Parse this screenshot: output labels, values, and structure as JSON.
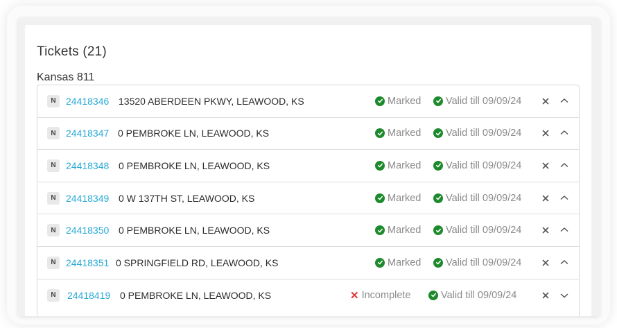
{
  "header": {
    "title": "Tickets (21)",
    "subtitle": "Kansas 811"
  },
  "colors": {
    "link": "#27a9d6",
    "success": "#1e8a2e",
    "error": "#e53935",
    "muted": "#8a8a8a"
  },
  "tickets": [
    {
      "badge": "N",
      "id": "24418346",
      "address": "13520 ABERDEEN PKWY, LEAWOOD, KS",
      "status": "Marked",
      "status_icon": "check-circle-icon",
      "valid": "Valid till 09/09/24",
      "expanded": true
    },
    {
      "badge": "N",
      "id": "24418347",
      "address": "0 PEMBROKE LN, LEAWOOD, KS",
      "status": "Marked",
      "status_icon": "check-circle-icon",
      "valid": "Valid till 09/09/24",
      "expanded": true
    },
    {
      "badge": "N",
      "id": "24418348",
      "address": "0 PEMBROKE LN, LEAWOOD, KS",
      "status": "Marked",
      "status_icon": "check-circle-icon",
      "valid": "Valid till 09/09/24",
      "expanded": true
    },
    {
      "badge": "N",
      "id": "24418349",
      "address": "0 W 137TH ST, LEAWOOD, KS",
      "status": "Marked",
      "status_icon": "check-circle-icon",
      "valid": "Valid till 09/09/24",
      "expanded": true
    },
    {
      "badge": "N",
      "id": "24418350",
      "address": "0 PEMBROKE LN, LEAWOOD, KS",
      "status": "Marked",
      "status_icon": "check-circle-icon",
      "valid": "Valid till 09/09/24",
      "expanded": true
    },
    {
      "badge": "N",
      "id": "24418351",
      "address": "0 SPRINGFIELD RD, LEAWOOD, KS",
      "status": "Marked",
      "status_icon": "check-circle-icon",
      "valid": "Valid till 09/09/24",
      "expanded": true
    },
    {
      "badge": "N",
      "id": "24418419",
      "address": "0 PEMBROKE LN, LEAWOOD, KS",
      "status": "Incomplete",
      "status_icon": "x-icon",
      "valid": "Valid till 09/09/24",
      "expanded": false
    }
  ]
}
